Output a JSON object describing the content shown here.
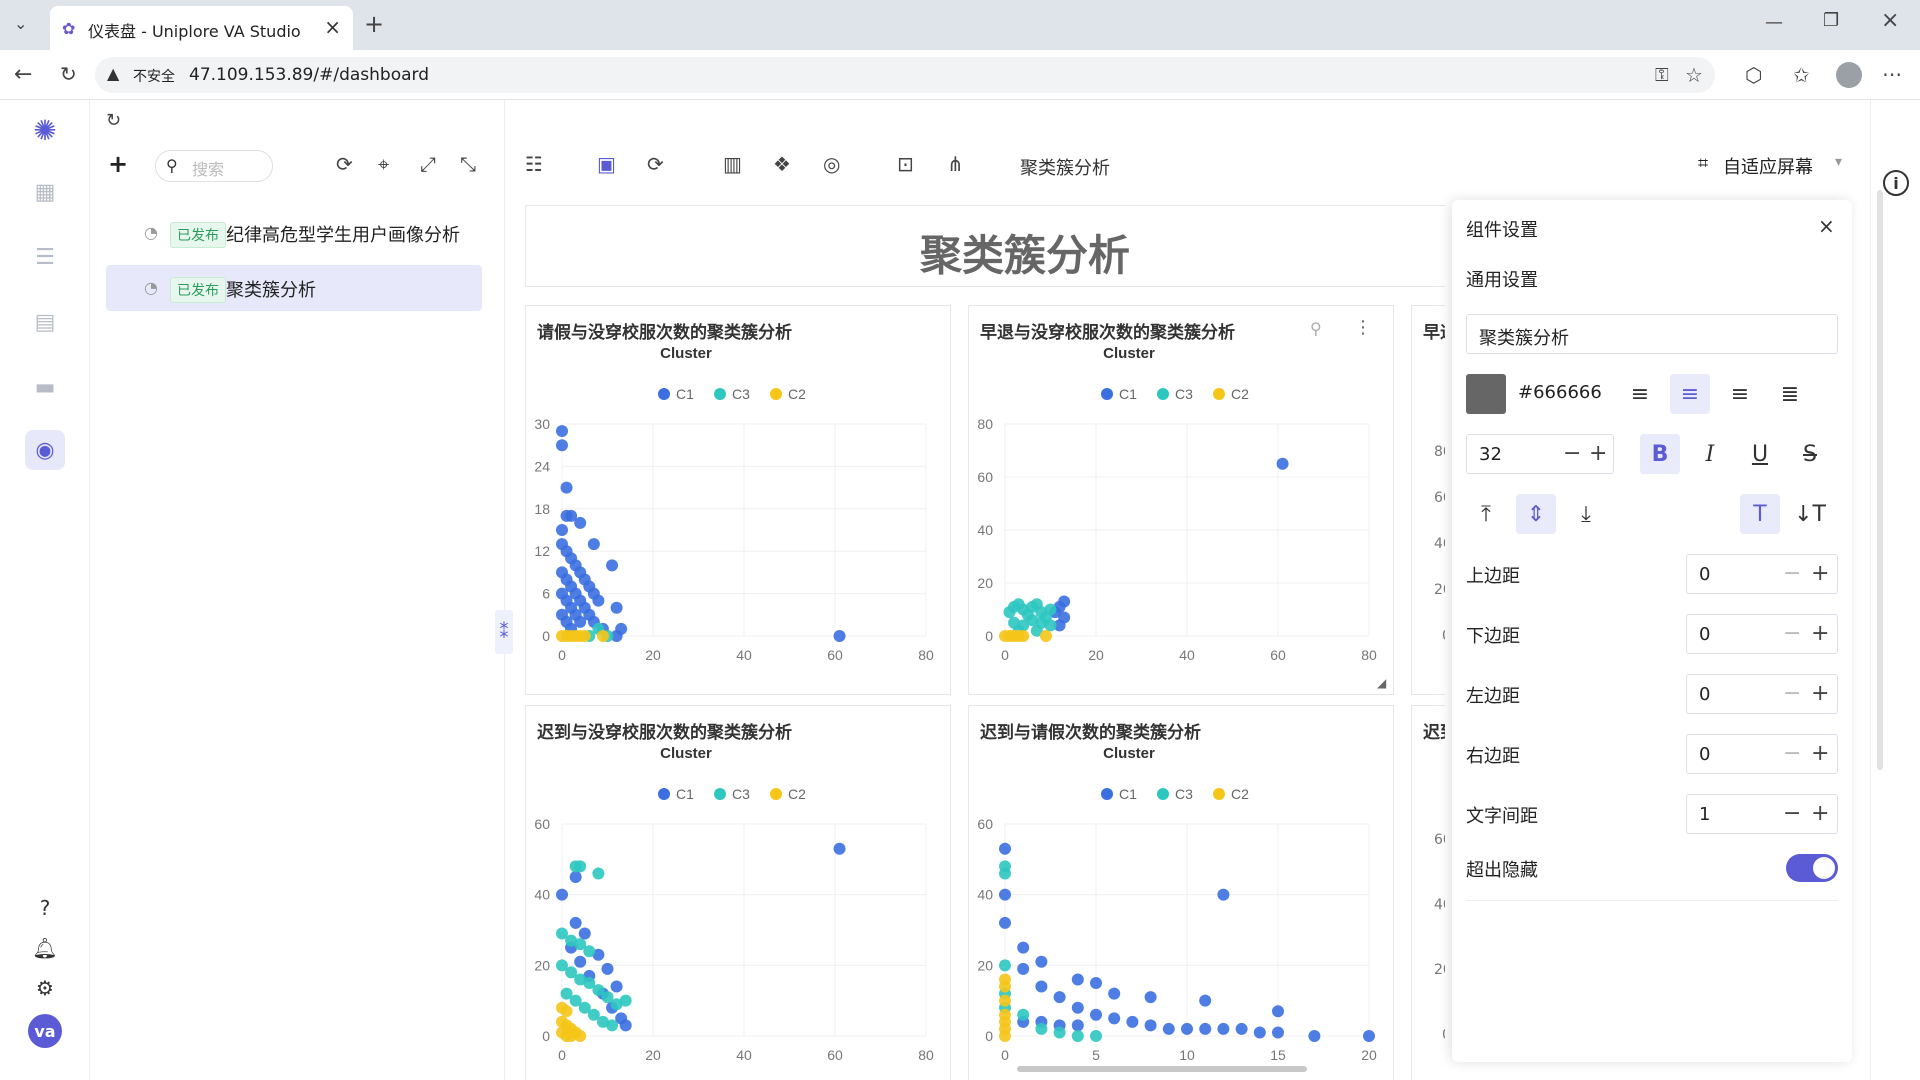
{
  "browser": {
    "tab_title": "仪表盘 - Uniplore VA Studio",
    "insecure_label": "不安全",
    "url": "47.109.153.89/#/dashboard"
  },
  "tree": {
    "search_placeholder": "搜索",
    "items": [
      {
        "badge": "已发布",
        "name": "纪律高危型学生用户画像分析",
        "active": false
      },
      {
        "badge": "已发布",
        "name": "聚类簇分析",
        "active": true
      }
    ]
  },
  "toolbar": {
    "dashboard_name": "聚类簇分析",
    "fit_label": "自适应屏幕"
  },
  "dashboard": {
    "title": "聚类簇分析",
    "legend_title": "Cluster"
  },
  "colors": {
    "C1": "#3b6fe0",
    "C3": "#2ec7c0",
    "C2": "#f5c518",
    "accent": "#5b5bd6"
  },
  "chart_data": [
    {
      "type": "scatter",
      "title": "请假与没穿校服次数的聚类簇分析",
      "legend_title": "Cluster",
      "legend": [
        "C1",
        "C3",
        "C2"
      ],
      "xlim": [
        0,
        80
      ],
      "xticks": [
        0,
        20,
        40,
        60,
        80
      ],
      "ylim": [
        0,
        30
      ],
      "yticks": [
        0,
        6,
        12,
        18,
        24,
        30
      ],
      "series": [
        {
          "name": "C1",
          "points": [
            [
              0,
              29
            ],
            [
              0,
              27
            ],
            [
              1,
              21
            ],
            [
              1,
              17
            ],
            [
              2,
              17
            ],
            [
              4,
              16
            ],
            [
              7,
              13
            ],
            [
              11,
              10
            ],
            [
              0,
              15
            ],
            [
              0,
              13
            ],
            [
              1,
              12
            ],
            [
              2,
              11
            ],
            [
              3,
              10
            ],
            [
              4,
              9
            ],
            [
              5,
              8
            ],
            [
              6,
              7
            ],
            [
              7,
              6
            ],
            [
              8,
              5
            ],
            [
              12,
              4
            ],
            [
              0,
              9
            ],
            [
              1,
              8
            ],
            [
              2,
              7
            ],
            [
              3,
              6
            ],
            [
              4,
              5
            ],
            [
              5,
              4
            ],
            [
              6,
              3
            ],
            [
              0,
              6
            ],
            [
              1,
              5
            ],
            [
              2,
              4
            ],
            [
              3,
              3
            ],
            [
              4,
              2
            ],
            [
              7,
              2
            ],
            [
              9,
              1
            ],
            [
              13,
              1
            ],
            [
              0,
              3
            ],
            [
              1,
              2
            ],
            [
              2,
              1
            ],
            [
              61,
              0
            ],
            [
              12,
              0
            ]
          ]
        },
        {
          "name": "C3",
          "points": [
            [
              6,
              0
            ],
            [
              10,
              0
            ],
            [
              8,
              1
            ]
          ]
        },
        {
          "name": "C2",
          "points": [
            [
              0,
              0
            ],
            [
              1,
              0
            ],
            [
              2,
              0
            ],
            [
              3,
              0
            ],
            [
              4,
              0
            ],
            [
              5,
              0
            ],
            [
              9,
              0
            ]
          ]
        }
      ]
    },
    {
      "type": "scatter",
      "title": "早退与没穿校服次数的聚类簇分析",
      "legend_title": "Cluster",
      "legend": [
        "C1",
        "C3",
        "C2"
      ],
      "xlim": [
        0,
        80
      ],
      "xticks": [
        0,
        20,
        40,
        60,
        80
      ],
      "ylim": [
        0,
        80
      ],
      "yticks": [
        0,
        20,
        40,
        60,
        80
      ],
      "series": [
        {
          "name": "C1",
          "points": [
            [
              61,
              65
            ],
            [
              13,
              13
            ],
            [
              12,
              11
            ],
            [
              11,
              9
            ],
            [
              13,
              7
            ],
            [
              12,
              4
            ]
          ]
        },
        {
          "name": "C3",
          "points": [
            [
              1,
              9
            ],
            [
              2,
              11
            ],
            [
              3,
              12
            ],
            [
              4,
              10
            ],
            [
              5,
              8
            ],
            [
              6,
              11
            ],
            [
              7,
              12
            ],
            [
              8,
              9
            ],
            [
              9,
              7
            ],
            [
              10,
              10
            ],
            [
              2,
              5
            ],
            [
              4,
              4
            ],
            [
              6,
              6
            ],
            [
              8,
              5
            ],
            [
              10,
              4
            ],
            [
              3,
              2
            ],
            [
              7,
              2
            ]
          ]
        },
        {
          "name": "C2",
          "points": [
            [
              0,
              0
            ],
            [
              1,
              0
            ],
            [
              2,
              0
            ],
            [
              3,
              0
            ],
            [
              4,
              0
            ],
            [
              9,
              0
            ]
          ]
        }
      ]
    },
    {
      "type": "scatter",
      "title": "迟到与没穿校服次数的聚类簇分析",
      "legend_title": "Cluster",
      "legend": [
        "C1",
        "C3",
        "C2"
      ],
      "xlim": [
        0,
        80
      ],
      "xticks": [
        0,
        20,
        40,
        60,
        80
      ],
      "ylim": [
        0,
        60
      ],
      "yticks": [
        0,
        20,
        40,
        60
      ],
      "series": [
        {
          "name": "C1",
          "points": [
            [
              61,
              53
            ],
            [
              0,
              40
            ],
            [
              3,
              45
            ],
            [
              3,
              32
            ],
            [
              5,
              29
            ],
            [
              8,
              23
            ],
            [
              10,
              19
            ],
            [
              12,
              14
            ],
            [
              14,
              3
            ],
            [
              2,
              25
            ],
            [
              4,
              21
            ],
            [
              6,
              17
            ],
            [
              9,
              12
            ],
            [
              11,
              8
            ],
            [
              13,
              5
            ]
          ]
        },
        {
          "name": "C3",
          "points": [
            [
              3,
              48
            ],
            [
              4,
              48
            ],
            [
              8,
              46
            ],
            [
              0,
              29
            ],
            [
              2,
              27
            ],
            [
              4,
              26
            ],
            [
              6,
              24
            ],
            [
              0,
              20
            ],
            [
              2,
              18
            ],
            [
              4,
              16
            ],
            [
              6,
              15
            ],
            [
              8,
              13
            ],
            [
              10,
              11
            ],
            [
              12,
              9
            ],
            [
              14,
              10
            ],
            [
              1,
              12
            ],
            [
              3,
              10
            ],
            [
              5,
              8
            ],
            [
              7,
              6
            ],
            [
              9,
              4
            ],
            [
              11,
              3
            ]
          ]
        },
        {
          "name": "C2",
          "points": [
            [
              0,
              4
            ],
            [
              1,
              3
            ],
            [
              2,
              2
            ],
            [
              3,
              1
            ],
            [
              0,
              1
            ],
            [
              1,
              0
            ],
            [
              2,
              0
            ],
            [
              4,
              0
            ],
            [
              0,
              8
            ],
            [
              1,
              7
            ]
          ]
        }
      ]
    },
    {
      "type": "scatter",
      "title": "迟到与请假次数的聚类簇分析",
      "legend_title": "Cluster",
      "legend": [
        "C1",
        "C3",
        "C2"
      ],
      "xlim": [
        0,
        20
      ],
      "xticks": [
        0,
        5,
        10,
        15,
        20
      ],
      "ylim": [
        0,
        60
      ],
      "yticks": [
        0,
        20,
        40,
        60
      ],
      "series": [
        {
          "name": "C1",
          "points": [
            [
              0,
              53
            ],
            [
              0,
              40
            ],
            [
              12,
              40
            ],
            [
              0,
              32
            ],
            [
              1,
              25
            ],
            [
              2,
              21
            ],
            [
              4,
              16
            ],
            [
              5,
              15
            ],
            [
              6,
              12
            ],
            [
              8,
              11
            ],
            [
              11,
              10
            ],
            [
              15,
              7
            ],
            [
              1,
              19
            ],
            [
              2,
              14
            ],
            [
              3,
              11
            ],
            [
              4,
              8
            ],
            [
              5,
              6
            ],
            [
              6,
              5
            ],
            [
              7,
              4
            ],
            [
              8,
              3
            ],
            [
              9,
              2
            ],
            [
              10,
              2
            ],
            [
              11,
              2
            ],
            [
              12,
              2
            ],
            [
              13,
              2
            ],
            [
              14,
              1
            ],
            [
              15,
              1
            ],
            [
              17,
              0
            ],
            [
              20,
              0
            ],
            [
              1,
              4
            ],
            [
              2,
              4
            ],
            [
              3,
              3
            ],
            [
              4,
              3
            ]
          ]
        },
        {
          "name": "C3",
          "points": [
            [
              0,
              48
            ],
            [
              0,
              46
            ],
            [
              0,
              20
            ],
            [
              1,
              6
            ],
            [
              2,
              2
            ],
            [
              3,
              1
            ],
            [
              4,
              0
            ],
            [
              5,
              0
            ],
            [
              0,
              12
            ],
            [
              0,
              8
            ]
          ]
        },
        {
          "name": "C2",
          "points": [
            [
              0,
              16
            ],
            [
              0,
              14
            ],
            [
              0,
              10
            ],
            [
              0,
              6
            ],
            [
              0,
              4
            ],
            [
              0,
              2
            ],
            [
              0,
              0
            ]
          ]
        }
      ]
    }
  ],
  "partial_cards": [
    {
      "title_fragment": "早退",
      "yticks": [
        "80",
        "60",
        "40",
        "20",
        "0"
      ]
    },
    {
      "title_fragment": "迟到",
      "yticks": [
        "60",
        "40",
        "20",
        "0"
      ]
    }
  ],
  "settings": {
    "title": "组件设置",
    "section": "通用设置",
    "text_value": "聚类簇分析",
    "color_value": "#666666",
    "font_size": "32",
    "rows": [
      {
        "label": "上边距",
        "value": "0"
      },
      {
        "label": "下边距",
        "value": "0"
      },
      {
        "label": "左边距",
        "value": "0"
      },
      {
        "label": "右边距",
        "value": "0"
      },
      {
        "label": "文字间距",
        "value": "1"
      }
    ],
    "overflow_label": "超出隐藏",
    "overflow_on": true
  },
  "user": {
    "avatar_text": "va"
  }
}
